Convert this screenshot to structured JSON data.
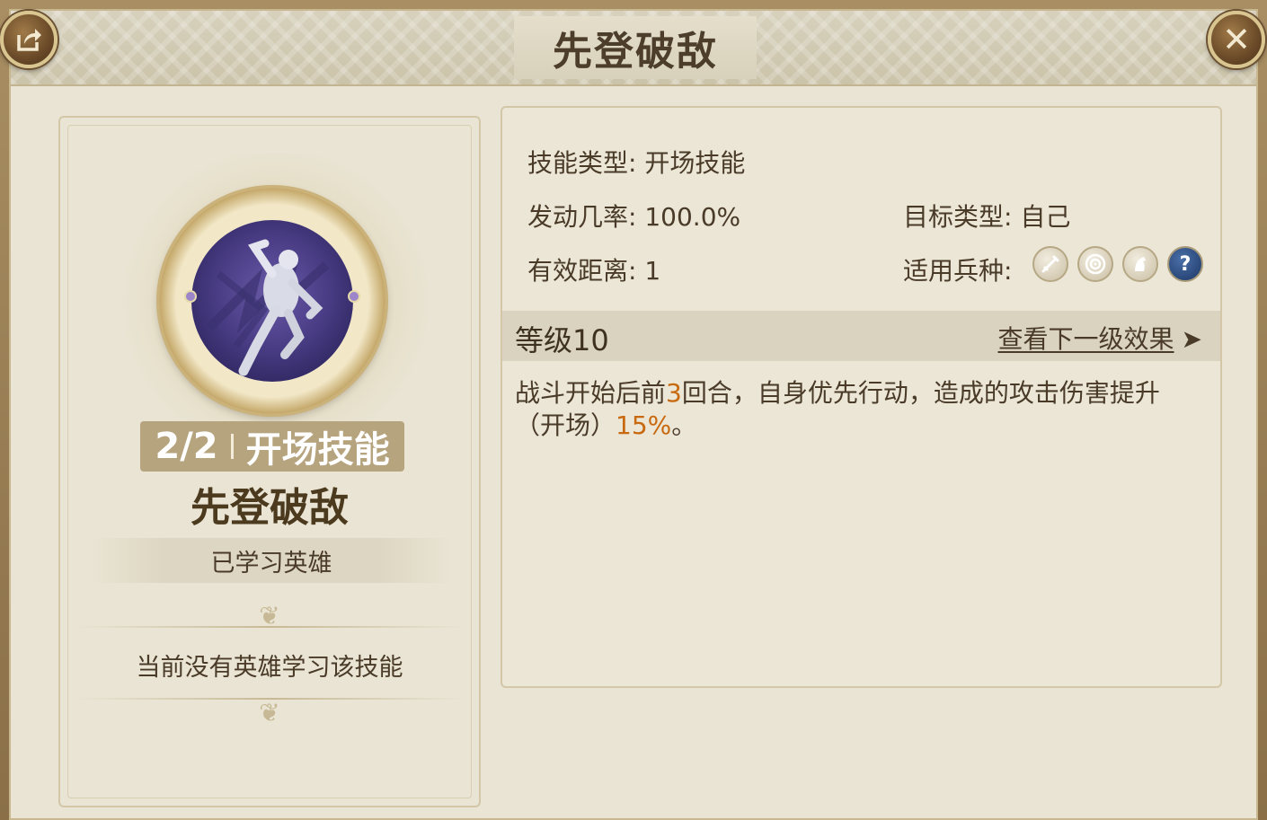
{
  "window": {
    "title": "先登破敌"
  },
  "skill_card": {
    "count": "2/2",
    "type": "开场技能",
    "name": "先登破敌",
    "learned_label": "已学习英雄",
    "empty_note": "当前没有英雄学习该技能"
  },
  "info": {
    "skill_type_label": "技能类型:",
    "skill_type_value": "开场技能",
    "trigger_rate_label": "发动几率:",
    "trigger_rate_value": "100.0%",
    "target_type_label": "目标类型:",
    "target_type_value": "自己",
    "range_label": "有效距离:",
    "range_value": "1",
    "unit_types_label": "适用兵种:",
    "unit_types": [
      "sword-icon",
      "bow-target-icon",
      "horse-icon",
      "help-icon"
    ],
    "unit_help_symbol": "?"
  },
  "level": {
    "label": "等级10",
    "next_link": "查看下一级效果",
    "next_arrow": "➤"
  },
  "description": {
    "part1": "战斗开始后前",
    "rounds": "3",
    "part2": "回合，自身优先行动，造成的攻击伤害提升（开场）",
    "percent": "15%",
    "part3": "。"
  },
  "colors": {
    "highlight": "#c9690f",
    "panel_bg": "#e9e4d3",
    "frame": "#8a6f47"
  }
}
